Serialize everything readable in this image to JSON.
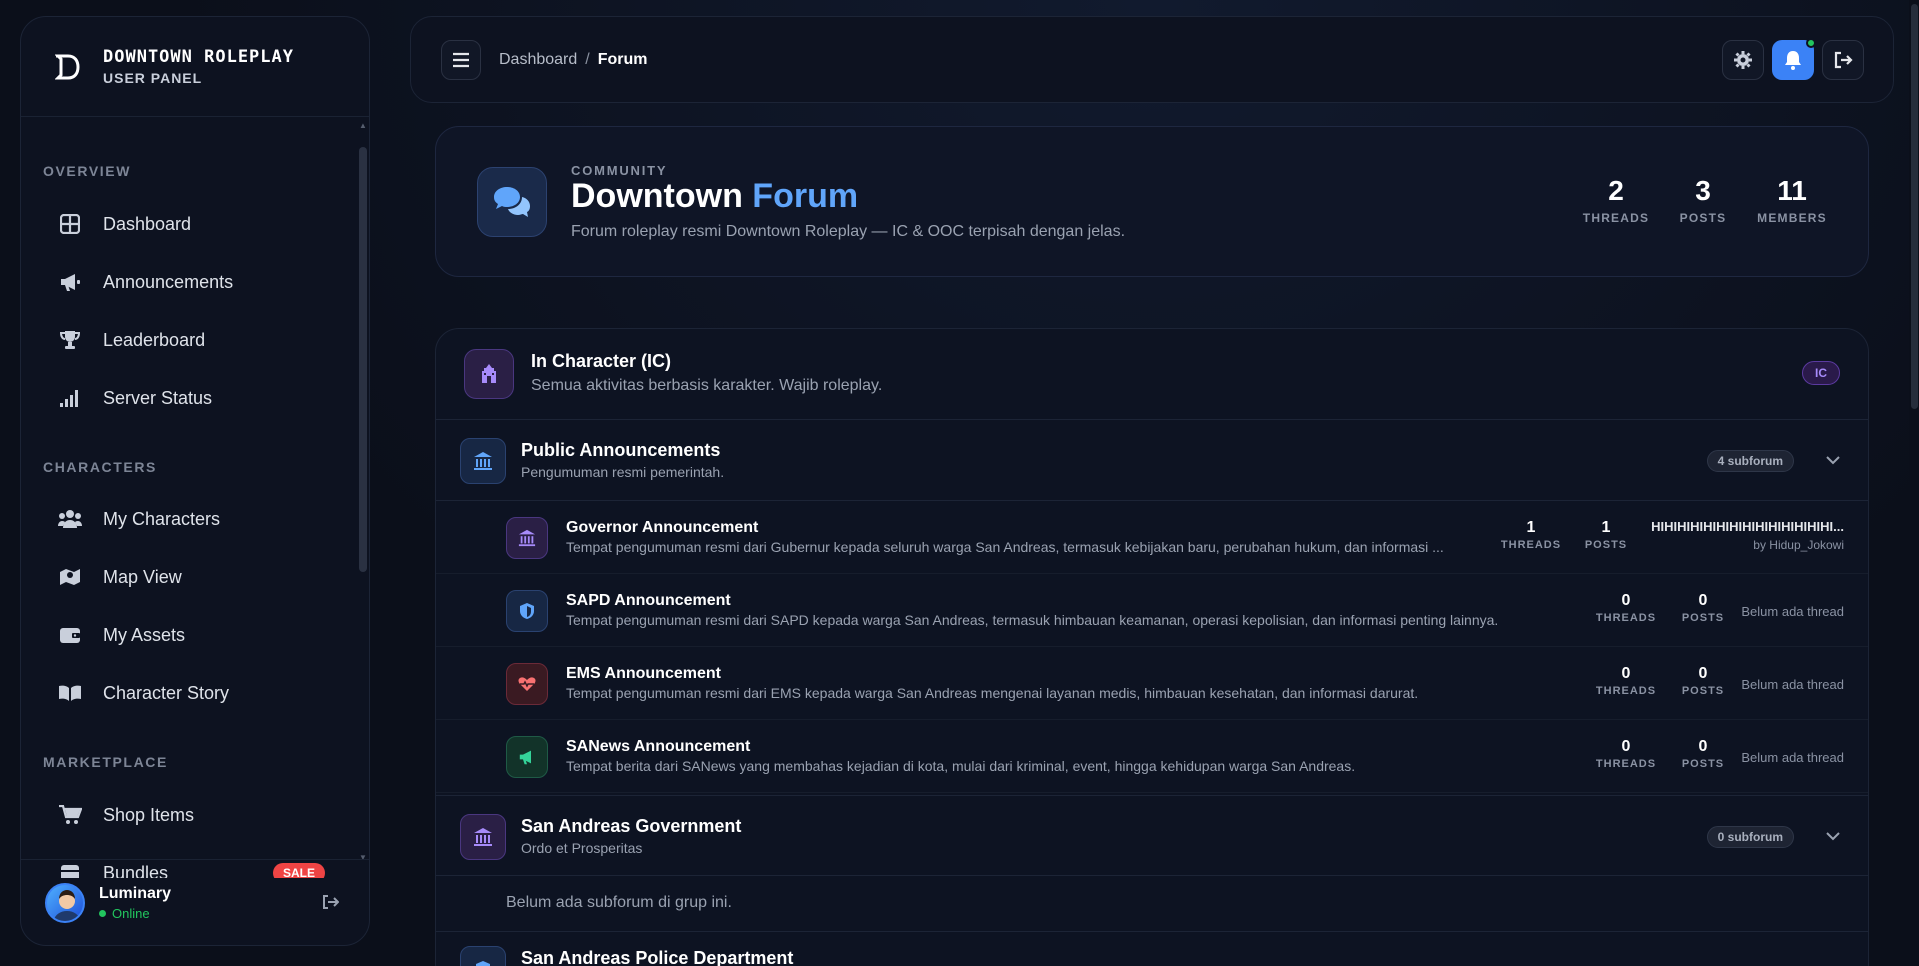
{
  "brand": {
    "name": "DOWNTOWN ROLEPLAY",
    "sub": "USER PANEL"
  },
  "sidebar": {
    "sections": [
      {
        "label": "OVERVIEW"
      },
      {
        "label": "CHARACTERS"
      },
      {
        "label": "MARKETPLACE"
      }
    ],
    "items": [
      {
        "label": "Dashboard",
        "icon": "grid-icon"
      },
      {
        "label": "Announcements",
        "icon": "megaphone-icon"
      },
      {
        "label": "Leaderboard",
        "icon": "trophy-icon"
      },
      {
        "label": "Server Status",
        "icon": "signal-icon"
      },
      {
        "label": "My Characters",
        "icon": "users-icon"
      },
      {
        "label": "Map View",
        "icon": "map-icon"
      },
      {
        "label": "My Assets",
        "icon": "wallet-icon"
      },
      {
        "label": "Character Story",
        "icon": "book-icon"
      },
      {
        "label": "Shop Items",
        "icon": "cart-icon"
      },
      {
        "label": "Bundles",
        "icon": "box-icon",
        "badge": "SALE"
      }
    ],
    "user": {
      "name": "Luminary",
      "status": "Online"
    }
  },
  "topbar": {
    "breadcrumb": [
      "Dashboard",
      "Forum"
    ],
    "separator": "/"
  },
  "hero": {
    "eyebrow": "COMMUNITY",
    "title_main": "Downtown",
    "title_accent": "Forum",
    "description": "Forum roleplay resmi Downtown Roleplay — IC & OOC terpisah dengan jelas.",
    "stats": [
      {
        "value": "2",
        "label": "THREADS"
      },
      {
        "value": "3",
        "label": "POSTS"
      },
      {
        "value": "11",
        "label": "MEMBERS"
      }
    ]
  },
  "category": {
    "title": "In Character (IC)",
    "description": "Semua aktivitas berbasis karakter. Wajib roleplay.",
    "badge": "IC"
  },
  "groups": [
    {
      "title": "Public Announcements",
      "description": "Pengumuman resmi pemerintah.",
      "subforum_badge": "4 subforum",
      "subforums": [
        {
          "title": "Governor Announcement",
          "description": "Tempat pengumuman resmi dari Gubernur kepada seluruh warga San Andreas, termasuk kebijakan baru, perubahan hukum, dan informasi ...",
          "threads": "1",
          "posts": "1",
          "threads_label": "THREADS",
          "posts_label": "POSTS",
          "last_title": "HIHIHIHIHIHIHIHIHIHIHIHIHIHI...",
          "last_by": "by Hidup_Jokowi"
        },
        {
          "title": "SAPD Announcement",
          "description": "Tempat pengumuman resmi dari SAPD kepada warga San Andreas, termasuk himbauan keamanan, operasi kepolisian, dan informasi penting lainnya.",
          "threads": "0",
          "posts": "0",
          "threads_label": "THREADS",
          "posts_label": "POSTS",
          "empty": "Belum ada thread"
        },
        {
          "title": "EMS Announcement",
          "description": "Tempat pengumuman resmi dari EMS kepada warga San Andreas mengenai layanan medis, himbauan kesehatan, dan informasi darurat.",
          "threads": "0",
          "posts": "0",
          "threads_label": "THREADS",
          "posts_label": "POSTS",
          "empty": "Belum ada thread"
        },
        {
          "title": "SANews Announcement",
          "description": "Tempat berita dari SANews yang membahas kejadian di kota, mulai dari kriminal, event, hingga kehidupan warga San Andreas.",
          "threads": "0",
          "posts": "0",
          "threads_label": "THREADS",
          "posts_label": "POSTS",
          "empty": "Belum ada thread"
        }
      ]
    },
    {
      "title": "San Andreas Government",
      "description": "Ordo et Prosperitas",
      "subforum_badge": "0 subforum",
      "empty": "Belum ada subforum di grup ini."
    },
    {
      "title": "San Andreas Police Department"
    }
  ],
  "colors": {
    "accent": "#60a5fa",
    "bell": "#3b82f6",
    "online": "#22c55e",
    "sale": "#ef4444"
  }
}
